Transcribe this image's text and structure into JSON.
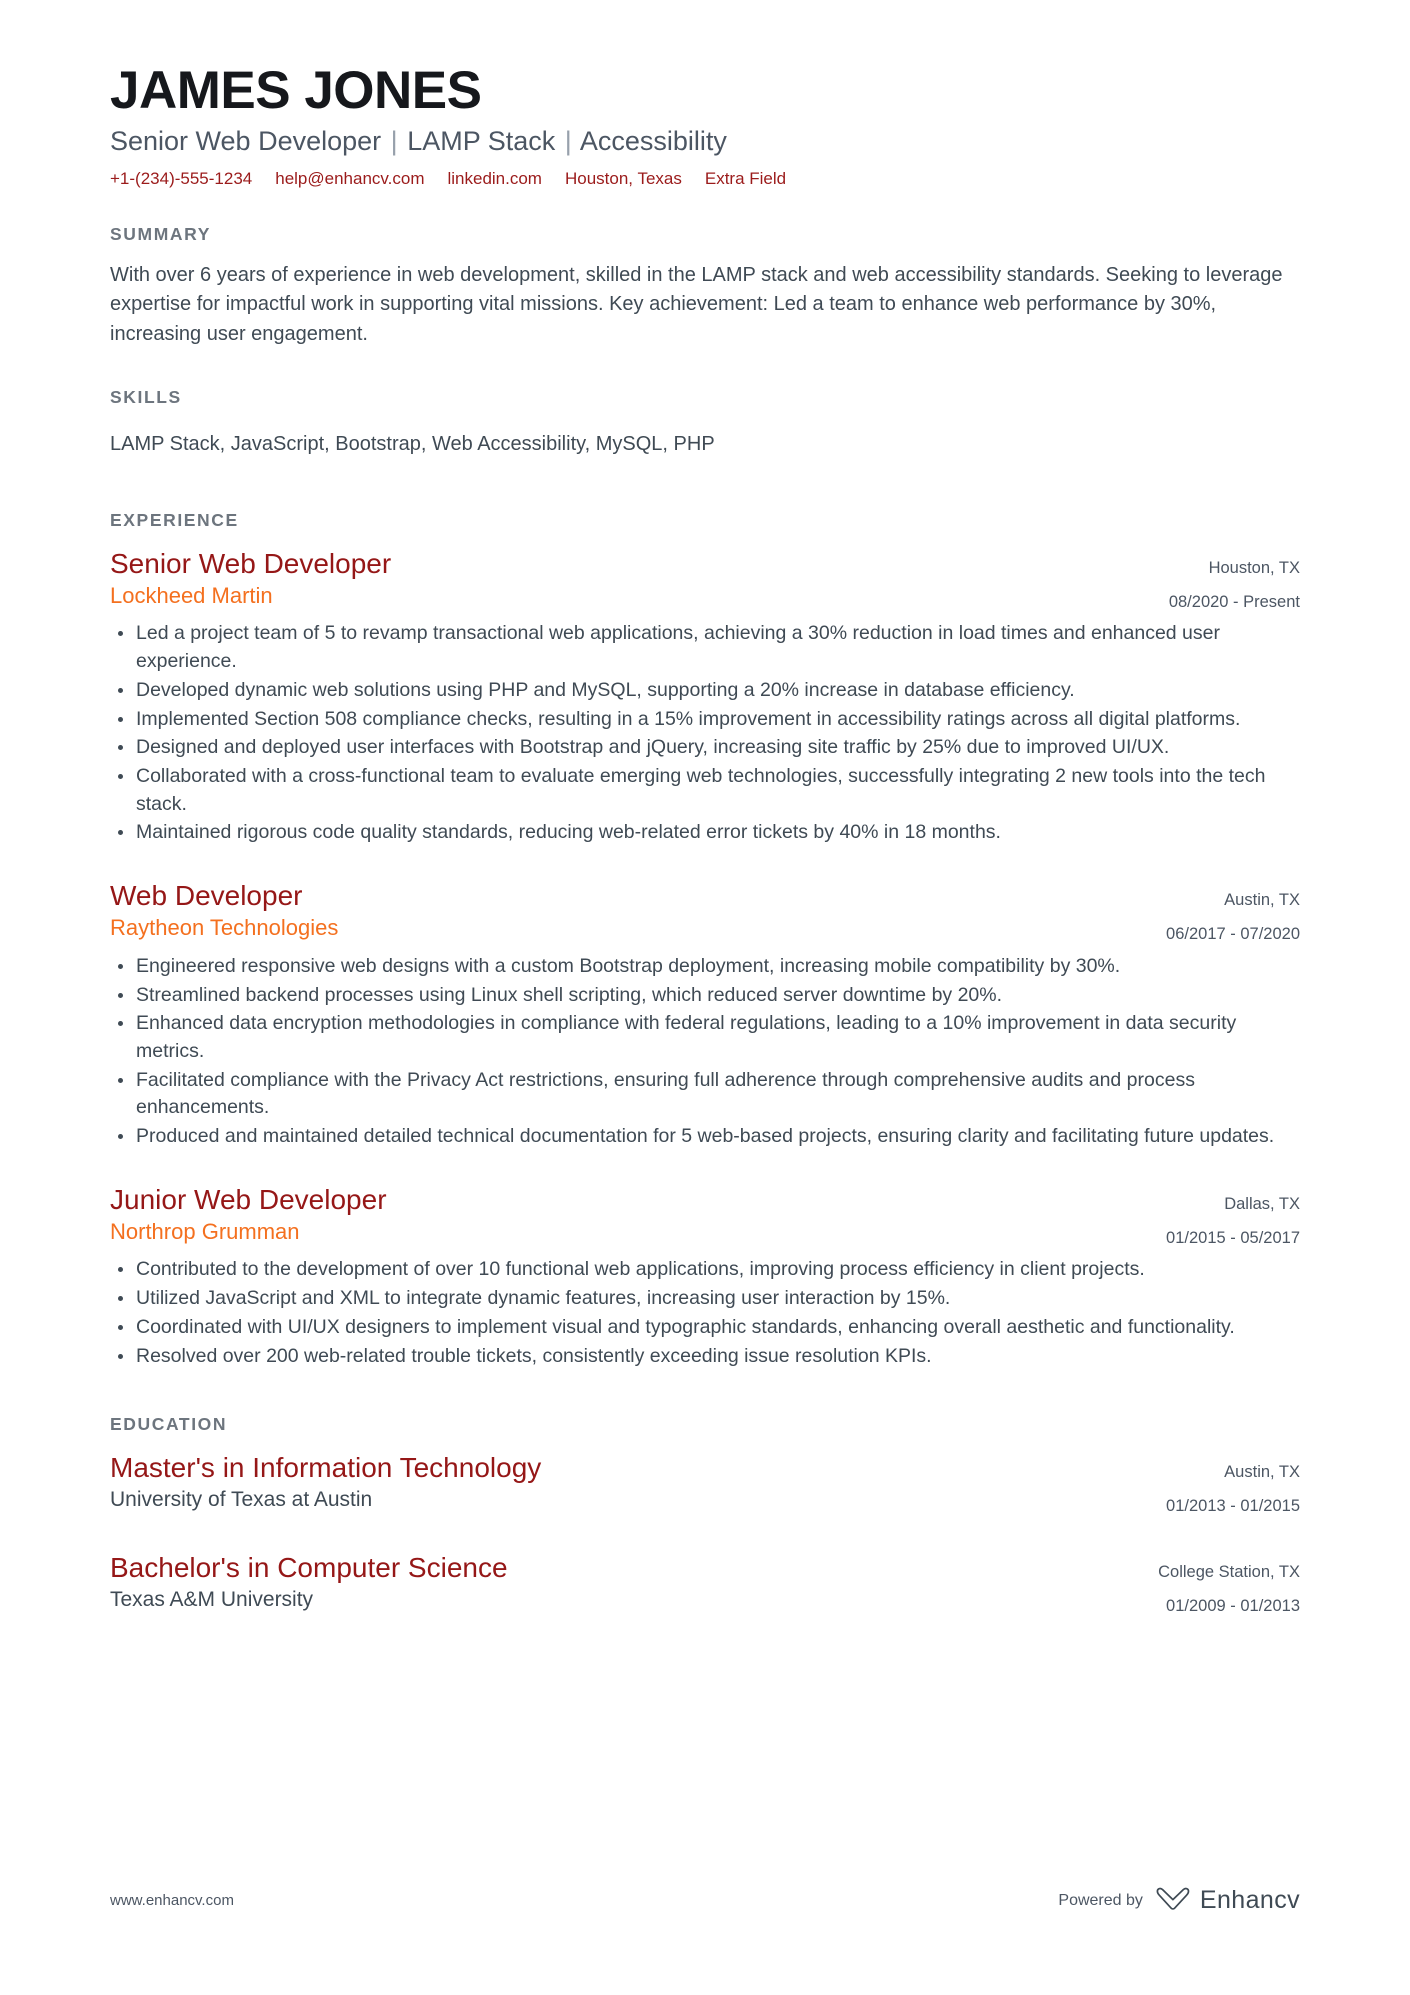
{
  "header": {
    "full_name": "JAMES JONES",
    "headline_parts": [
      "Senior Web Developer",
      "LAMP Stack",
      "Accessibility"
    ],
    "headline_divider": "|",
    "contacts": [
      {
        "name": "phone",
        "label": "+1-(234)-555-1234"
      },
      {
        "name": "email",
        "label": "help@enhancv.com"
      },
      {
        "name": "linkedin",
        "label": "linkedin.com"
      },
      {
        "name": "location",
        "label": "Houston, Texas"
      },
      {
        "name": "extra-field",
        "label": "Extra Field"
      }
    ]
  },
  "sections": {
    "summary": {
      "title": "SUMMARY",
      "body": "With over 6 years of experience in web development, skilled in the LAMP stack and web accessibility standards. Seeking to leverage expertise for impactful work in supporting vital missions. Key achievement: Led a team to enhance web performance by 30%, increasing user engagement."
    },
    "skills": {
      "title": "SKILLS",
      "body": "LAMP Stack, JavaScript, Bootstrap, Web Accessibility, MySQL, PHP"
    },
    "experience": {
      "title": "EXPERIENCE",
      "entries": [
        {
          "title": "Senior Web Developer",
          "organization": "Lockheed Martin",
          "location": "Houston, TX",
          "dates": "08/2020 - Present",
          "bullets": [
            "Led a project team of 5 to revamp transactional web applications, achieving a 30% reduction in load times and enhanced user experience.",
            "Developed dynamic web solutions using PHP and MySQL, supporting a 20% increase in database efficiency.",
            "Implemented Section 508 compliance checks, resulting in a 15% improvement in accessibility ratings across all digital platforms.",
            "Designed and deployed user interfaces with Bootstrap and jQuery, increasing site traffic by 25% due to improved UI/UX.",
            "Collaborated with a cross-functional team to evaluate emerging web technologies, successfully integrating 2 new tools into the tech stack.",
            "Maintained rigorous code quality standards, reducing web-related error tickets by 40% in 18 months."
          ]
        },
        {
          "title": "Web Developer",
          "organization": "Raytheon Technologies",
          "location": "Austin, TX",
          "dates": "06/2017 - 07/2020",
          "bullets": [
            "Engineered responsive web designs with a custom Bootstrap deployment, increasing mobile compatibility by 30%.",
            "Streamlined backend processes using Linux shell scripting, which reduced server downtime by 20%.",
            "Enhanced data encryption methodologies in compliance with federal regulations, leading to a 10% improvement in data security metrics.",
            "Facilitated compliance with the Privacy Act restrictions, ensuring full adherence through comprehensive audits and process enhancements.",
            "Produced and maintained detailed technical documentation for 5 web-based projects, ensuring clarity and facilitating future updates."
          ]
        },
        {
          "title": "Junior Web Developer",
          "organization": "Northrop Grumman",
          "location": "Dallas, TX",
          "dates": "01/2015 - 05/2017",
          "bullets": [
            "Contributed to the development of over 10 functional web applications, improving process efficiency in client projects.",
            "Utilized JavaScript and XML to integrate dynamic features, increasing user interaction by 15%.",
            "Coordinated with UI/UX designers to implement visual and typographic standards, enhancing overall aesthetic and functionality.",
            "Resolved over 200 web-related trouble tickets, consistently exceeding issue resolution KPIs."
          ]
        }
      ]
    },
    "education": {
      "title": "EDUCATION",
      "entries": [
        {
          "title": "Master's in Information Technology",
          "organization": "University of Texas at Austin",
          "location": "Austin, TX",
          "dates": "01/2013 - 01/2015"
        },
        {
          "title": "Bachelor's in Computer Science",
          "organization": "Texas A&M University",
          "location": "College Station, TX",
          "dates": "01/2009 - 01/2013"
        }
      ]
    }
  },
  "footer": {
    "website": "www.enhancv.com",
    "powered_by": "Powered by",
    "brand_name": "Enhancv",
    "brand_icon": "enhancv-infinity-logo"
  },
  "colors": {
    "accent_red": "#951717",
    "accent_orange": "#f4701f",
    "contact_red": "#9b1b1b",
    "section_heading": "#6d757e",
    "body_text": "#3f4a54"
  }
}
